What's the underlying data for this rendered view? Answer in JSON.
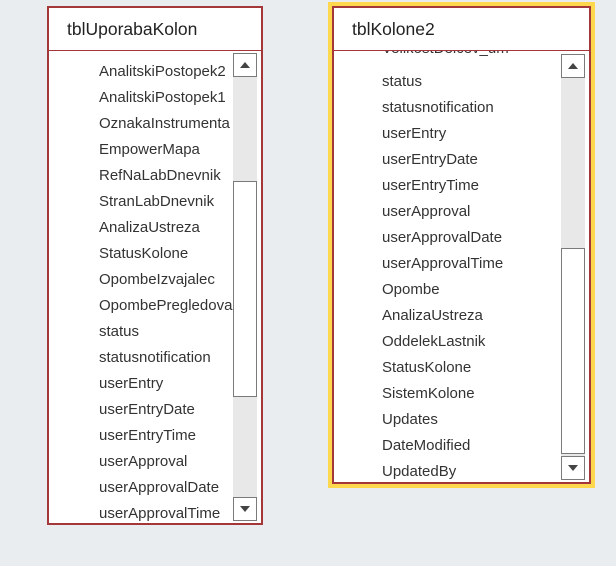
{
  "table1": {
    "title": "tblUporabaKolon",
    "fields": [
      "AnalitskiPostopek2",
      "AnalitskiPostopek1",
      "OznakaInstrumenta",
      "EmpowerMapa",
      "RefNaLabDnevnik",
      "StranLabDnevnik",
      "AnalizaUstreza",
      "StatusKolone",
      "OpombeIzvajalec",
      "OpombePregledova",
      "status",
      "statusnotification",
      "userEntry",
      "userEntryDate",
      "userEntryTime",
      "userApproval",
      "userApprovalDate",
      "userApprovalTime"
    ]
  },
  "table2": {
    "title": "tblKolone2",
    "partial_field": "VelikostDelcev_um",
    "fields": [
      "status",
      "statusnotification",
      "userEntry",
      "userEntryDate",
      "userEntryTime",
      "userApproval",
      "userApprovalDate",
      "userApprovalTime",
      "Opombe",
      "AnalizaUstreza",
      "OddelekLastnik",
      "StatusKolone",
      "SistemKolone",
      "Updates",
      "DateModified",
      "UpdatedBy"
    ]
  },
  "icons": {
    "scroll_up": "chevron-up-icon",
    "scroll_down": "chevron-down-icon"
  },
  "colors": {
    "border": "#a4373a",
    "selected_highlight": "#ffd84d",
    "canvas": "#eaedf0"
  }
}
